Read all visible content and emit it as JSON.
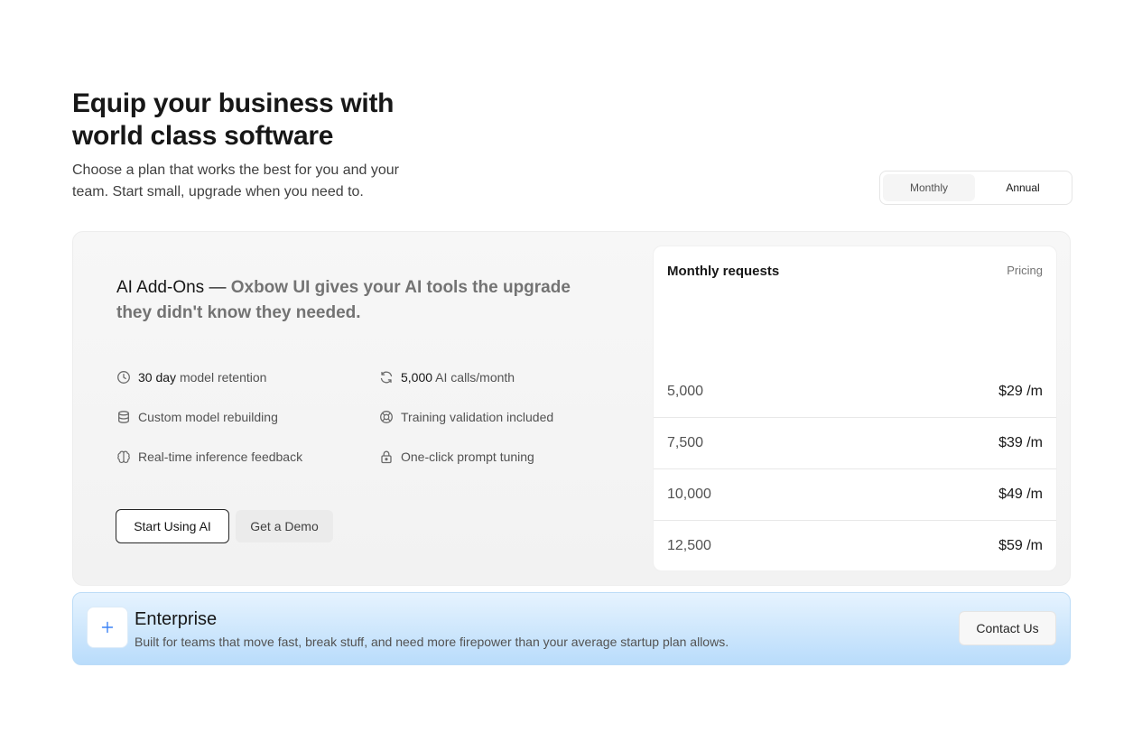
{
  "hero": {
    "title": "Equip your business with world class software",
    "subtitle": "Choose a plan that works the best for you and your team. Start small, upgrade when you need to."
  },
  "billing_toggle": {
    "monthly_label": "Monthly",
    "annual_label": "Annual",
    "selected": "Annual"
  },
  "ai_addons": {
    "heading_strong": "AI Add-Ons —",
    "heading_rest": "Oxbow UI gives your AI tools the upgrade they didn't know they needed.",
    "features": [
      {
        "icon": "clock-icon",
        "bold": "30 day",
        "text": "model retention"
      },
      {
        "icon": "refresh-icon",
        "bold": "5,000",
        "text": "AI calls/month"
      },
      {
        "icon": "database-icon",
        "bold": "",
        "text": "Custom model rebuilding"
      },
      {
        "icon": "lifebuoy-icon",
        "bold": "",
        "text": "Training validation included"
      },
      {
        "icon": "brain-icon",
        "bold": "",
        "text": "Real-time inference feedback"
      },
      {
        "icon": "lock-icon",
        "bold": "",
        "text": "One-click prompt tuning"
      }
    ],
    "primary_button": "Start Using AI",
    "secondary_button": "Get a Demo"
  },
  "pricing_table": {
    "header_left": "Monthly requests",
    "header_right": "Pricing",
    "rows": [
      {
        "requests": "5,000",
        "price": "$29 /m"
      },
      {
        "requests": "7,500",
        "price": "$39 /m"
      },
      {
        "requests": "10,000",
        "price": "$49 /m"
      },
      {
        "requests": "12,500",
        "price": "$59 /m"
      }
    ]
  },
  "enterprise": {
    "icon": "plus-icon",
    "title": "Enterprise",
    "description": "Built for teams that move fast, break stuff, and need more firepower than your average startup plan allows.",
    "button": "Contact Us"
  },
  "colors": {
    "accent": "#3b82f6",
    "enterprise_top": "#e6f3fe",
    "enterprise_bottom": "#b9dcfb"
  }
}
